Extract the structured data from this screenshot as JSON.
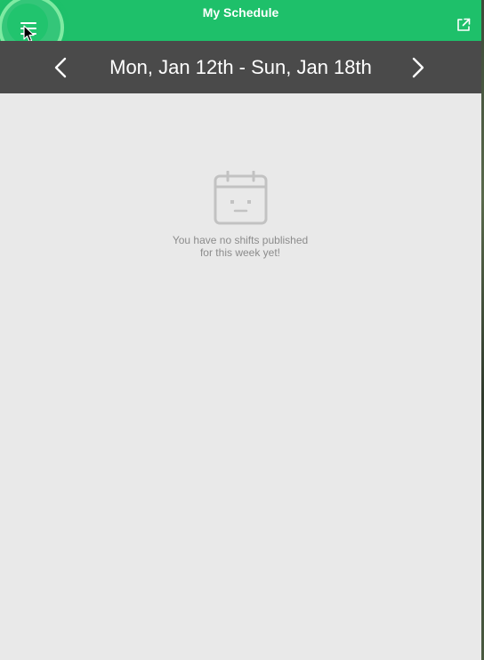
{
  "header": {
    "title": "My Schedule",
    "menu_icon": "hamburger-menu-icon",
    "external_icon": "external-link-icon",
    "accent_color": "#1ec06a"
  },
  "week_nav": {
    "label": "Mon, Jan 12th - Sun, Jan 18th",
    "prev_icon": "chevron-left-icon",
    "next_icon": "chevron-right-icon",
    "background": "#4a4a4a"
  },
  "empty_state": {
    "icon": "calendar-neutral-face-icon",
    "line1": "You have no shifts published",
    "line2": "for this week yet!"
  }
}
